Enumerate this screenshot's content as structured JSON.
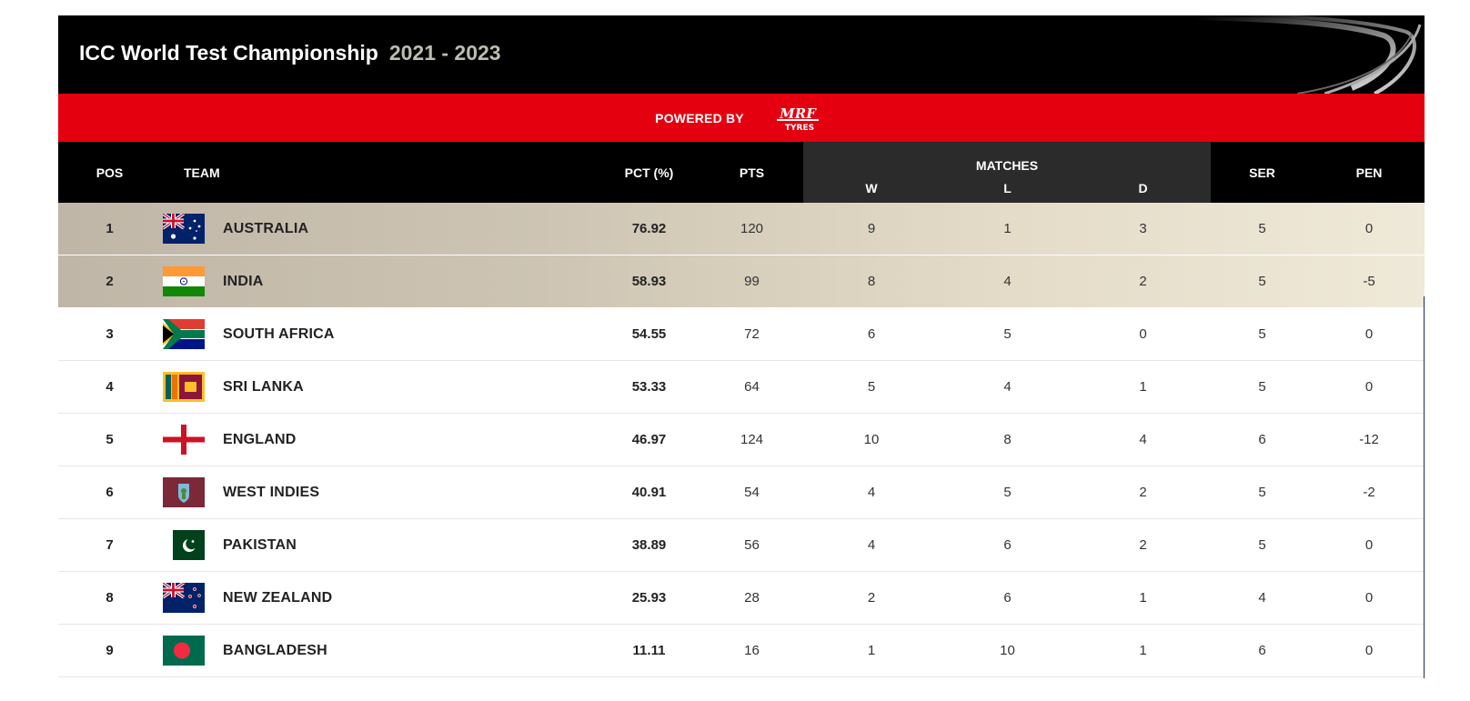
{
  "header": {
    "title": "ICC World Test Championship",
    "years": "2021 - 2023",
    "powered_by": "POWERED BY",
    "sponsor_logo_text": "MRF TYRES"
  },
  "columns": {
    "pos": "POS",
    "team": "TEAM",
    "pct": "PCT (%)",
    "pts": "PTS",
    "matches": "MATCHES",
    "w": "W",
    "l": "L",
    "d": "D",
    "ser": "SER",
    "pen": "PEN"
  },
  "rows": [
    {
      "pos": "1",
      "team": "AUSTRALIA",
      "flag": "australia-flag-icon",
      "pct": "76.92",
      "pts": "120",
      "w": "9",
      "l": "1",
      "d": "3",
      "ser": "5",
      "pen": "0",
      "highlight": true
    },
    {
      "pos": "2",
      "team": "INDIA",
      "flag": "india-flag-icon",
      "pct": "58.93",
      "pts": "99",
      "w": "8",
      "l": "4",
      "d": "2",
      "ser": "5",
      "pen": "-5",
      "highlight": true
    },
    {
      "pos": "3",
      "team": "SOUTH AFRICA",
      "flag": "south-africa-flag-icon",
      "pct": "54.55",
      "pts": "72",
      "w": "6",
      "l": "5",
      "d": "0",
      "ser": "5",
      "pen": "0",
      "highlight": false
    },
    {
      "pos": "4",
      "team": "SRI LANKA",
      "flag": "sri-lanka-flag-icon",
      "pct": "53.33",
      "pts": "64",
      "w": "5",
      "l": "4",
      "d": "1",
      "ser": "5",
      "pen": "0",
      "highlight": false
    },
    {
      "pos": "5",
      "team": "ENGLAND",
      "flag": "england-flag-icon",
      "pct": "46.97",
      "pts": "124",
      "w": "10",
      "l": "8",
      "d": "4",
      "ser": "6",
      "pen": "-12",
      "highlight": false
    },
    {
      "pos": "6",
      "team": "WEST INDIES",
      "flag": "west-indies-flag-icon",
      "pct": "40.91",
      "pts": "54",
      "w": "4",
      "l": "5",
      "d": "2",
      "ser": "5",
      "pen": "-2",
      "highlight": false
    },
    {
      "pos": "7",
      "team": "PAKISTAN",
      "flag": "pakistan-flag-icon",
      "pct": "38.89",
      "pts": "56",
      "w": "4",
      "l": "6",
      "d": "2",
      "ser": "5",
      "pen": "0",
      "highlight": false
    },
    {
      "pos": "8",
      "team": "NEW ZEALAND",
      "flag": "new-zealand-flag-icon",
      "pct": "25.93",
      "pts": "28",
      "w": "2",
      "l": "6",
      "d": "1",
      "ser": "4",
      "pen": "0",
      "highlight": false
    },
    {
      "pos": "9",
      "team": "BANGLADESH",
      "flag": "bangladesh-flag-icon",
      "pct": "11.11",
      "pts": "16",
      "w": "1",
      "l": "10",
      "d": "1",
      "ser": "6",
      "pen": "0",
      "highlight": false
    }
  ],
  "colors": {
    "header_bg": "#000000",
    "powered_bar": "#e4000f",
    "matches_header_bg": "#2b2b2b",
    "qualified_row_gradient_start": "#bfb6a7",
    "qualified_row_gradient_end": "#efe9d9"
  }
}
